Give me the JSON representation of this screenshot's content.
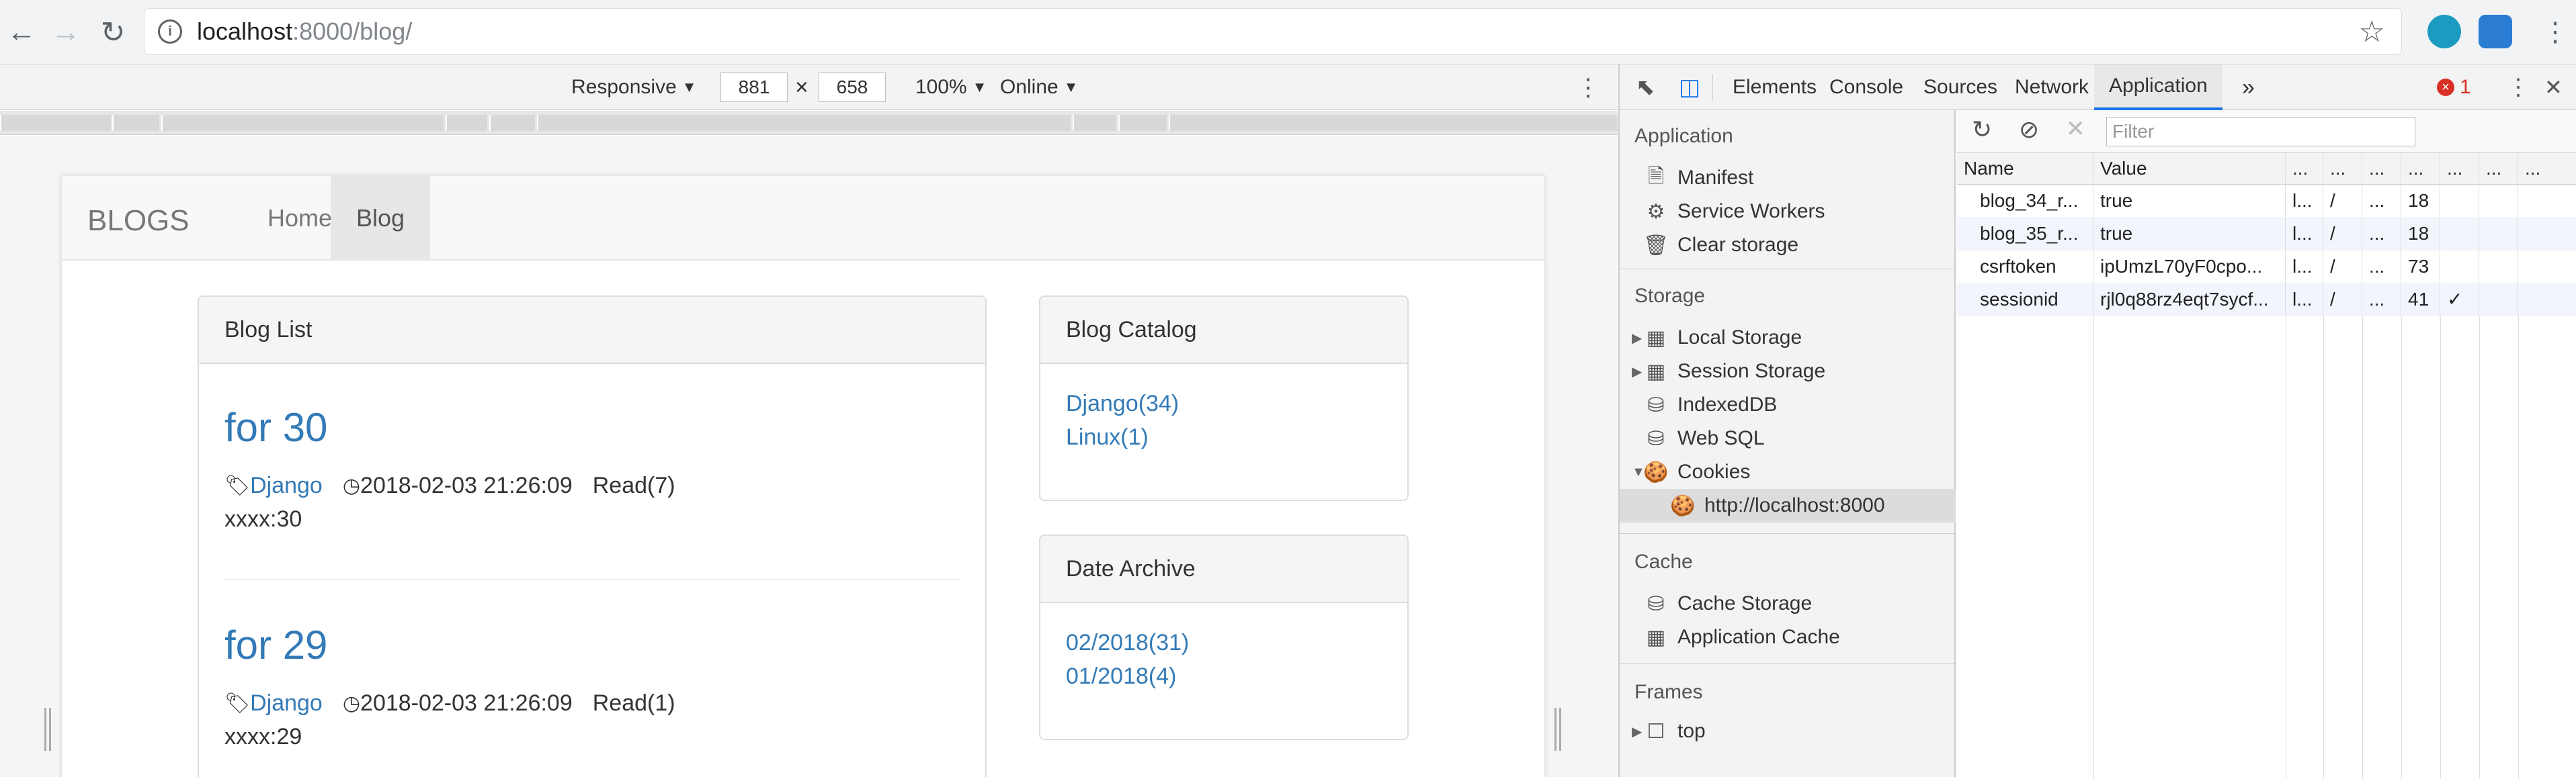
{
  "browser": {
    "url_host": "localhost",
    "url_rest": ":8000/blog/",
    "icons": {
      "back": "arrow-left-icon",
      "forward": "arrow-right-icon",
      "reload": "reload-icon",
      "info": "info-icon",
      "star": "star-icon",
      "menu": "kebab-menu-icon"
    }
  },
  "device_toolbar": {
    "mode": "Responsive",
    "width": "881",
    "times": "×",
    "height": "658",
    "zoom": "100%",
    "network": "Online"
  },
  "site": {
    "brand": "BLOGS",
    "nav": [
      {
        "label": "Home"
      },
      {
        "label": "Blog"
      }
    ],
    "blog_list": {
      "heading": "Blog List",
      "posts": [
        {
          "title": "for 30",
          "tag": "Django",
          "date": "2018-02-03 21:26:09",
          "read": "Read(7)",
          "body": "xxxx:30"
        },
        {
          "title": "for 29",
          "tag": "Django",
          "date": "2018-02-03 21:26:09",
          "read": "Read(1)",
          "body": "xxxx:29"
        }
      ]
    },
    "catalog": {
      "heading": "Blog Catalog",
      "items": [
        "Django(34)",
        "Linux(1)"
      ]
    },
    "archive": {
      "heading": "Date Archive",
      "items": [
        "02/2018(31)",
        "01/2018(4)"
      ]
    }
  },
  "devtools": {
    "tabs": [
      "Elements",
      "Console",
      "Sources",
      "Network",
      "Application"
    ],
    "active_tab": "Application",
    "more": "»",
    "error_count": "1",
    "close": "✕",
    "sidebar": {
      "application_title": "Application",
      "application_items": [
        "Manifest",
        "Service Workers",
        "Clear storage"
      ],
      "storage_title": "Storage",
      "storage_items": [
        "Local Storage",
        "Session Storage",
        "IndexedDB",
        "Web SQL",
        "Cookies"
      ],
      "cookie_origin": "http://localhost:8000",
      "cache_title": "Cache",
      "cache_items": [
        "Cache Storage",
        "Application Cache"
      ],
      "frames_title": "Frames",
      "frames_items": [
        "top"
      ]
    },
    "cookies": {
      "filter_placeholder": "Filter",
      "columns": [
        "Name",
        "Value",
        "...",
        "...",
        "...",
        "...",
        "...",
        "...",
        "..."
      ],
      "rows": [
        [
          "blog_34_r...",
          "true",
          "l...",
          "/",
          "...",
          "18",
          "",
          "",
          ""
        ],
        [
          "blog_35_r...",
          "true",
          "l...",
          "/",
          "...",
          "18",
          "",
          "",
          ""
        ],
        [
          "csrftoken",
          "ipUmzL70yF0cpo...",
          "l...",
          "/",
          "...",
          "73",
          "",
          "",
          ""
        ],
        [
          "sessionid",
          "rjl0q88rz4eqt7sycf...",
          "l...",
          "/",
          "...",
          "41",
          "✓",
          "",
          ""
        ]
      ]
    }
  }
}
